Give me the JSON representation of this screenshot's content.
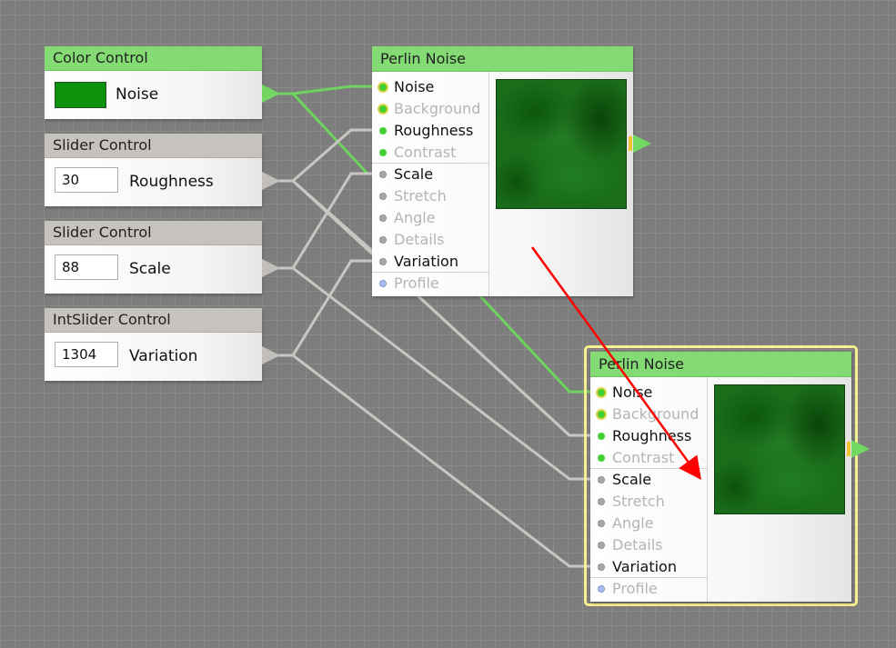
{
  "nodes": {
    "color_control": {
      "title": "Color Control",
      "label": "Noise",
      "swatch_color": "#0d920d"
    },
    "slider_roughness": {
      "title": "Slider Control",
      "value": "30",
      "label": "Roughness"
    },
    "slider_scale": {
      "title": "Slider Control",
      "value": "88",
      "label": "Scale"
    },
    "intslider_variation": {
      "title": "IntSlider Control",
      "value": "1304",
      "label": "Variation"
    },
    "perlin_top": {
      "title": "Perlin Noise",
      "params": [
        "Noise",
        "Background",
        "Roughness",
        "Contrast",
        "Scale",
        "Stretch",
        "Angle",
        "Details",
        "Variation",
        "Profile"
      ]
    },
    "perlin_bottom": {
      "title": "Perlin Noise",
      "params": [
        "Noise",
        "Background",
        "Roughness",
        "Contrast",
        "Scale",
        "Stretch",
        "Angle",
        "Details",
        "Variation",
        "Profile"
      ]
    }
  },
  "colors": {
    "header_green": "#84db74",
    "header_gray": "#c6c2bd",
    "wire_green": "#6fd35f",
    "wire_gray": "#c9c6c1",
    "selection": "#f6f08e",
    "annotation_arrow": "#ff0000"
  }
}
